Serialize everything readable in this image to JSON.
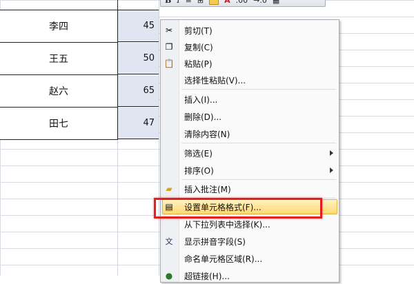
{
  "sheet": {
    "rows": [
      {
        "name": "李四",
        "value": "45"
      },
      {
        "name": "王五",
        "value": "50"
      },
      {
        "name": "赵六",
        "value": "65"
      },
      {
        "name": "田七",
        "value": "47"
      }
    ]
  },
  "toolbar": {
    "bold": "B",
    "italic": "I",
    "font_color": "A",
    "inc_decimal": ".00",
    "dec_decimal": "→.0"
  },
  "menu": {
    "items": [
      {
        "label": "剪切(T)",
        "icon": "scissors-icon"
      },
      {
        "label": "复制(C)",
        "icon": "copy-icon"
      },
      {
        "label": "粘贴(P)",
        "icon": "paste-icon"
      },
      {
        "label": "选择性粘贴(V)...",
        "icon": ""
      },
      {
        "label": "插入(I)...",
        "icon": ""
      },
      {
        "label": "删除(D)...",
        "icon": ""
      },
      {
        "label": "清除内容(N)",
        "icon": ""
      },
      {
        "label": "筛选(E)",
        "icon": "",
        "submenu": true
      },
      {
        "label": "排序(O)",
        "icon": "",
        "submenu": true
      },
      {
        "label": "插入批注(M)",
        "icon": "comment-icon"
      },
      {
        "label": "设置单元格格式(F)...",
        "icon": "format-cells-icon",
        "highlighted": true
      },
      {
        "label": "从下拉列表中选择(K)...",
        "icon": ""
      },
      {
        "label": "显示拼音字段(S)",
        "icon": "phonetic-icon"
      },
      {
        "label": "命名单元格区域(R)...",
        "icon": ""
      },
      {
        "label": "超链接(H)...",
        "icon": "hyperlink-icon"
      }
    ]
  },
  "colors": {
    "highlight": "#ffd873",
    "annotation_red": "#e02020",
    "selected_cell": "#dfe6f2"
  }
}
